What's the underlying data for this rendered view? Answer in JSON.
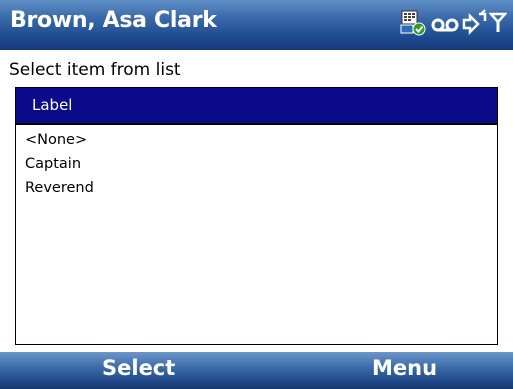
{
  "window": {
    "title": "Brown, Asa Clark",
    "status_icons": [
      "sync-icon",
      "voicemail-icon",
      "data-connection-icon",
      "signal-strength-icon"
    ]
  },
  "prompt": {
    "text": "Select item from list"
  },
  "list": {
    "header_label": "Label",
    "items": [
      {
        "label": "<None>"
      },
      {
        "label": "Captain"
      },
      {
        "label": "Reverend"
      }
    ]
  },
  "softkeys": {
    "left_label": "Select",
    "right_label": "Menu"
  },
  "colors": {
    "titlebar": "#1e4a8e",
    "list_header": "#0a0a8a",
    "softkey_bar": "#1f4788"
  }
}
